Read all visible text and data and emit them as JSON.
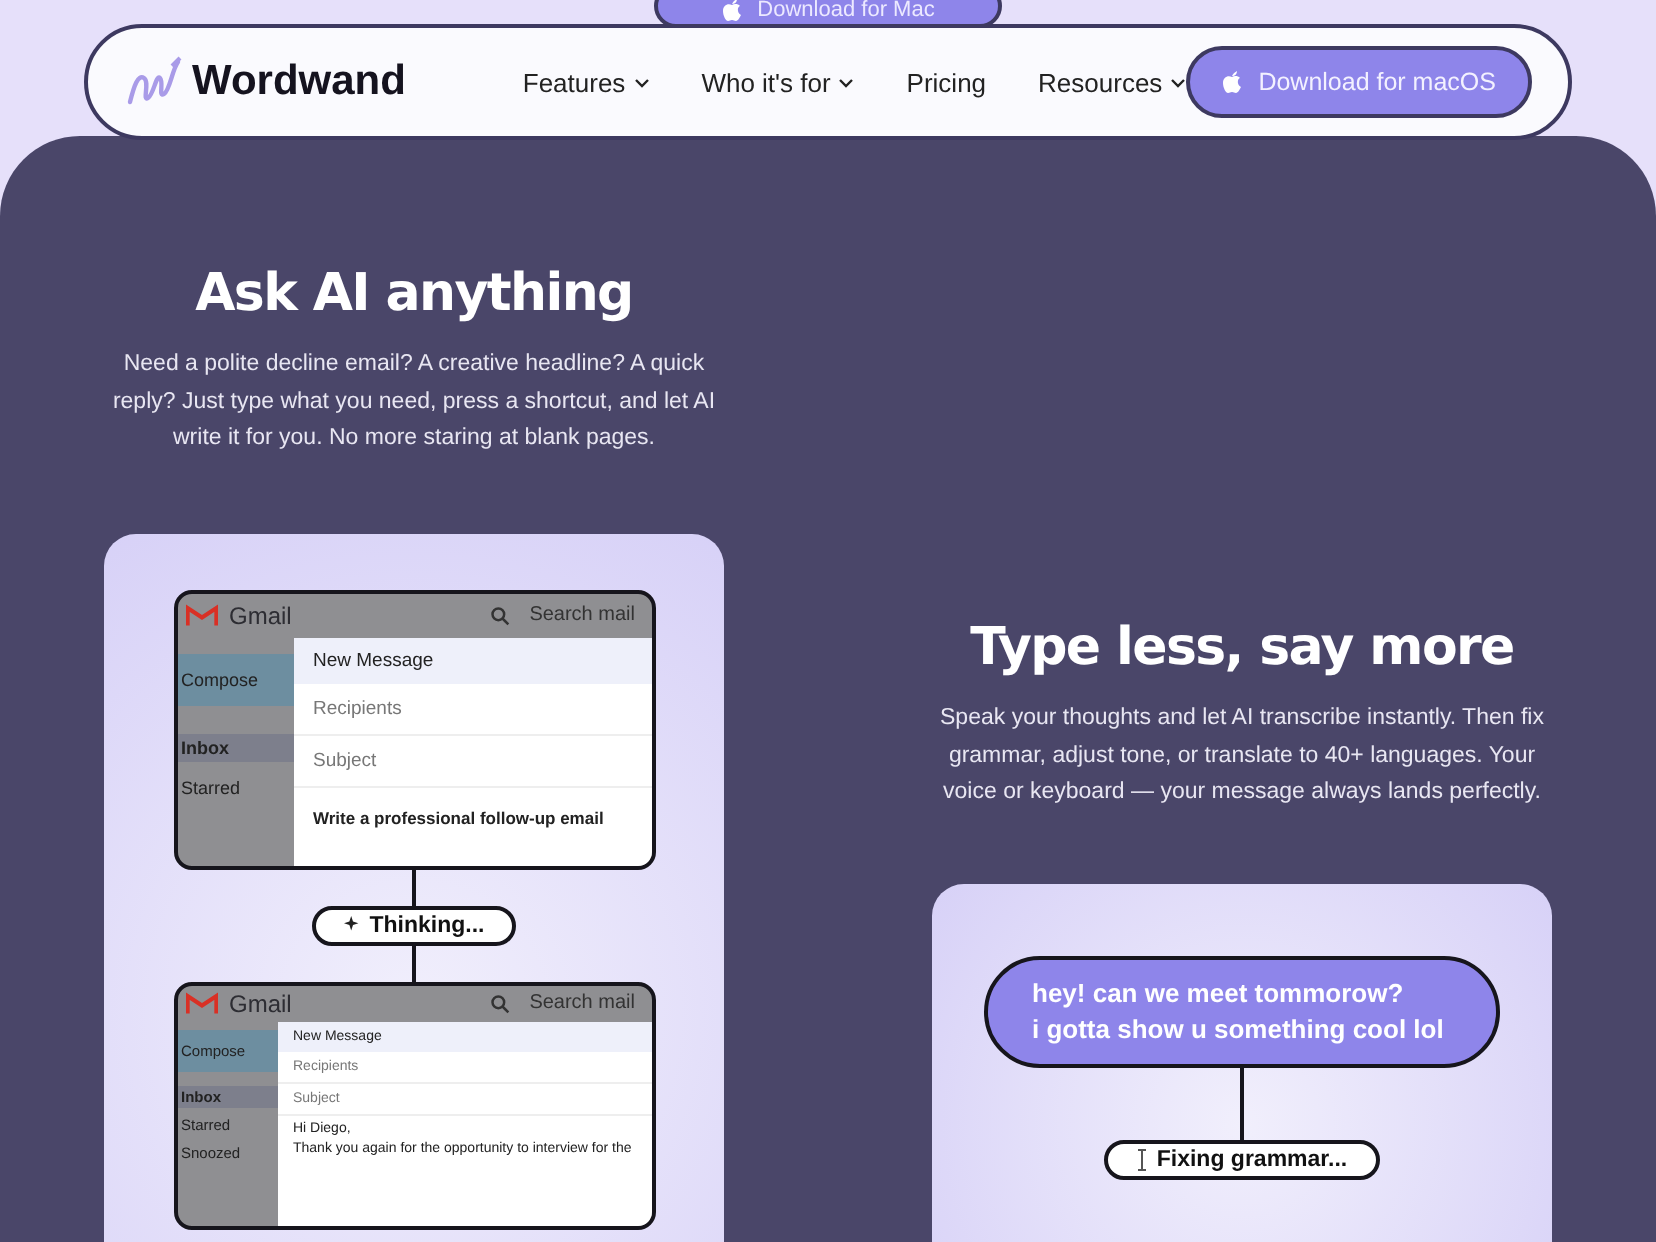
{
  "top_button": {
    "label": "Download for Mac"
  },
  "nav": {
    "brand": "Wordwand",
    "links": [
      {
        "label": "Features",
        "dropdown": true
      },
      {
        "label": "Who it's for",
        "dropdown": true
      },
      {
        "label": "Pricing",
        "dropdown": false
      },
      {
        "label": "Resources",
        "dropdown": true
      }
    ],
    "cta": "Download for macOS"
  },
  "sections": [
    {
      "title": "Ask AI anything",
      "text": "Need a polite decline email? A creative headline? A quick reply? Just type what you need, press a shortcut, and let AI write it for you. No more staring at blank pages.",
      "kind": "email",
      "demo": {
        "mock_before": {
          "app": "Gmail",
          "search": "Search mail",
          "sidebar": [
            "Compose",
            "Inbox",
            "Starred"
          ],
          "compose_title": "New Message",
          "fields": [
            "Recipients",
            "Subject"
          ],
          "body": [
            "Write a professional follow-up email"
          ]
        },
        "status": "Thinking...",
        "mock_after": {
          "app": "Gmail",
          "search": "Search mail",
          "sidebar": [
            "Compose",
            "Inbox",
            "Starred",
            "Snoozed"
          ],
          "compose_title": "New Message",
          "fields": [
            "Recipients",
            "Subject"
          ],
          "body": [
            "Hi Diego,",
            "Thank you again for the opportunity to interview for the"
          ]
        }
      }
    },
    {
      "title": "Type less, say more",
      "text": "Speak your thoughts and let AI transcribe instantly. Then fix grammar, adjust tone, or translate to 40+ languages. Your voice or keyboard — your message always lands perfectly.",
      "kind": "grammar",
      "demo": {
        "message": [
          "hey! can we meet tommorow?",
          "i gotta show u something cool lol"
        ],
        "status": "Fixing grammar..."
      }
    }
  ]
}
